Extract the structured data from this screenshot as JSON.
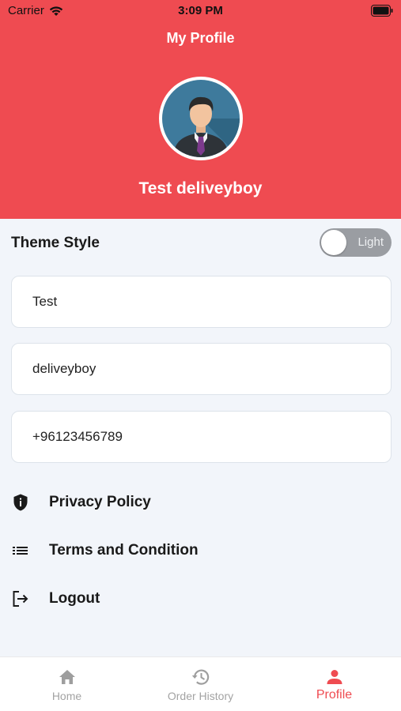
{
  "status_bar": {
    "carrier": "Carrier",
    "time": "3:09 PM"
  },
  "header": {
    "title": "My Profile",
    "user_name": "Test deliveyboy",
    "background": "#ef4b51"
  },
  "theme": {
    "label": "Theme Style",
    "toggle_text": "Light",
    "enabled": false
  },
  "fields": [
    {
      "value": "Test"
    },
    {
      "value": "deliveyboy"
    },
    {
      "value": "+96123456789"
    }
  ],
  "menu": [
    {
      "label": "Privacy Policy",
      "icon": "shield-icon"
    },
    {
      "label": "Terms and Condition",
      "icon": "list-icon"
    },
    {
      "label": "Logout",
      "icon": "logout-icon"
    }
  ],
  "bottom_nav": {
    "items": [
      {
        "label": "Home",
        "icon": "home-icon",
        "active": false
      },
      {
        "label": "Order History",
        "icon": "history-icon",
        "active": false
      },
      {
        "label": "Profile",
        "icon": "person-icon",
        "active": true
      }
    ],
    "active_color": "#ef4b51"
  }
}
